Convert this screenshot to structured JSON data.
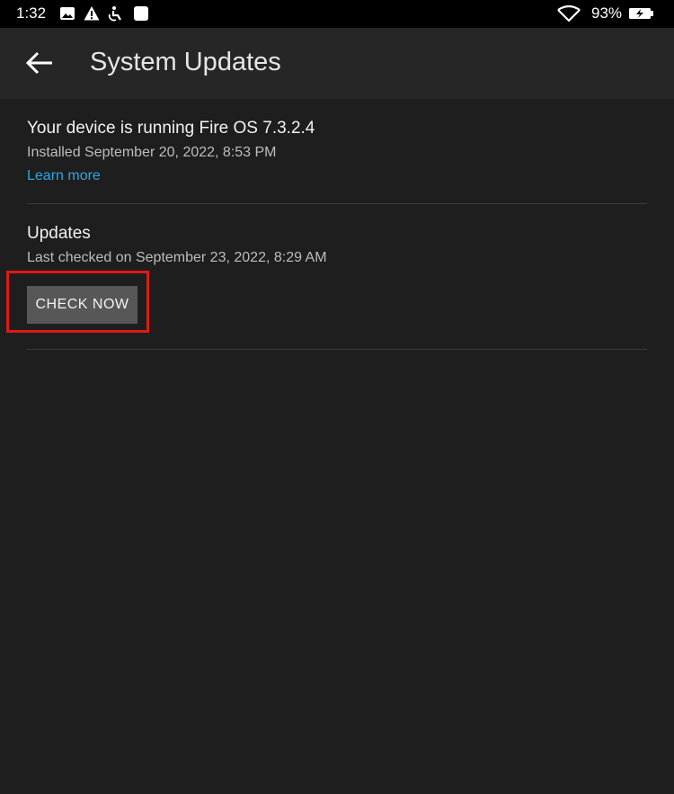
{
  "status_bar": {
    "time": "1:32",
    "battery_percent": "93%",
    "icons": [
      "image-icon",
      "warning-icon",
      "accessibility-icon",
      "app-icon",
      "wifi-icon",
      "battery-charging-icon"
    ]
  },
  "app_bar": {
    "title": "System Updates",
    "back_icon": "arrow-left-icon"
  },
  "device_info": {
    "title": "Your device is running Fire OS 7.3.2.4",
    "installed": "Installed September 20, 2022, 8:53 PM",
    "learn_more": "Learn more"
  },
  "updates": {
    "title": "Updates",
    "last_checked": "Last checked on September 23, 2022, 8:29 AM",
    "check_button": "CHECK NOW"
  },
  "colors": {
    "background": "#1e1e1e",
    "app_bar": "#262626",
    "link": "#2ba6e6",
    "button": "#575757",
    "highlight": "#e01818"
  }
}
